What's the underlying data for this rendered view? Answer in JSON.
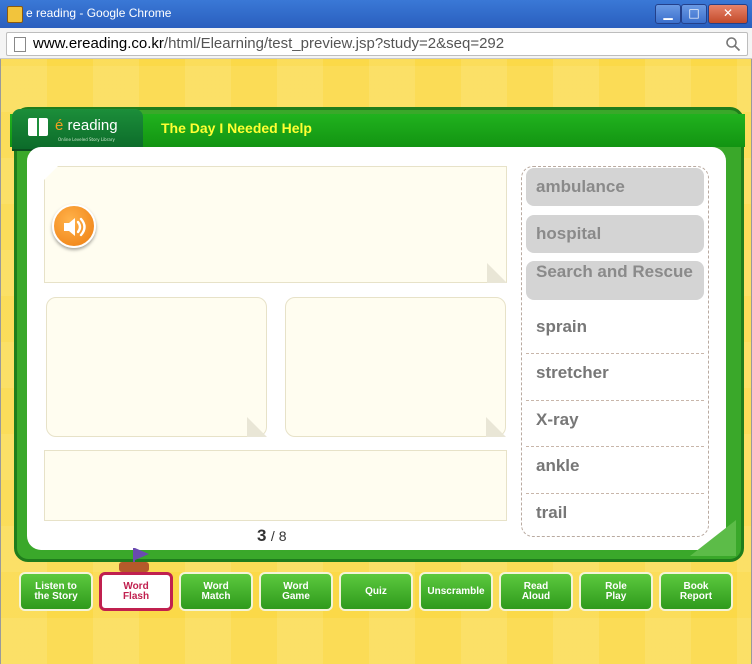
{
  "window": {
    "title": "e reading - Google Chrome",
    "controls": {
      "minimize": "▁",
      "maximize": "□",
      "close": "✕"
    }
  },
  "address": {
    "host": "www.ereading.co.kr",
    "path": "/html/Elearning/test_preview.jsp?study=2&seq=292"
  },
  "header": {
    "logo_brand": "reading",
    "logo_e": "é",
    "logo_tagline": "Online Leveled Story Library",
    "story_title": "The Day I Needed Help"
  },
  "pager": {
    "current": "3",
    "total": "/ 8"
  },
  "words": [
    {
      "text": "ambulance",
      "highlighted": true
    },
    {
      "text": "hospital",
      "highlighted": true
    },
    {
      "text": "Search and Rescue",
      "highlighted": true
    },
    {
      "text": "sprain",
      "highlighted": false
    },
    {
      "text": "stretcher",
      "highlighted": false
    },
    {
      "text": "X-ray",
      "highlighted": false
    },
    {
      "text": "ankle",
      "highlighted": false
    },
    {
      "text": "trail",
      "highlighted": false
    }
  ],
  "nav": [
    {
      "label": "Listen to\nthe Story",
      "active": false
    },
    {
      "label": "Word\nFlash",
      "active": true
    },
    {
      "label": "Word\nMatch",
      "active": false
    },
    {
      "label": "Word\nGame",
      "active": false
    },
    {
      "label": "Quiz",
      "active": false
    },
    {
      "label": "Unscramble",
      "active": false
    },
    {
      "label": "Read\nAloud",
      "active": false
    },
    {
      "label": "Role\nPlay",
      "active": false
    },
    {
      "label": "Book\nReport",
      "active": false
    }
  ],
  "colors": {
    "accent_green": "#21b21e",
    "title_yellow": "#ffff33",
    "active_nav": "#c0204f"
  }
}
